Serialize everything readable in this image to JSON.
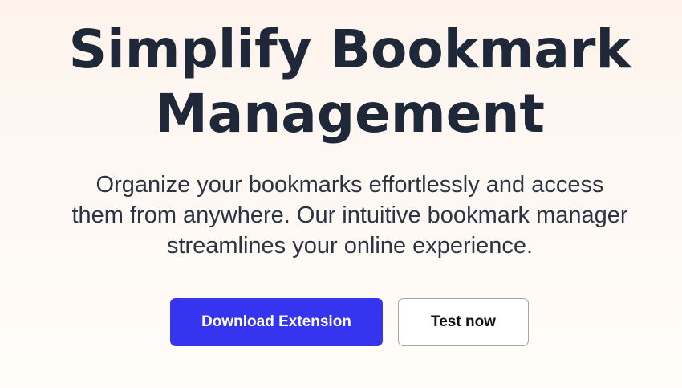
{
  "hero": {
    "headline_line1": "Simplify Bookmark",
    "headline_line2": "Management",
    "subtitle_line1": "Organize your bookmarks effortlessly and access",
    "subtitle_line2": "them from anywhere. Our intuitive bookmark manager",
    "subtitle_line3": "streamlines your online experience."
  },
  "actions": {
    "primary_label": "Download Extension",
    "secondary_label": "Test now"
  },
  "colors": {
    "primary_button": "#3535f0",
    "headline": "#1e2838",
    "background_top": "#fdf3ec",
    "background_bottom": "#fffcf9"
  }
}
